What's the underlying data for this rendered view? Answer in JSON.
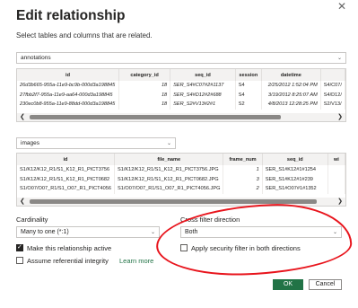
{
  "dialog": {
    "title": "Edit relationship",
    "subtitle": "Select tables and columns that are related."
  },
  "table1": {
    "selected": "annotations",
    "columns": [
      "id",
      "category_id",
      "seq_id",
      "session",
      "datetime"
    ],
    "rows": [
      [
        "26d3b665-955a-11e9-bc9b-000d3a198845",
        "18",
        "SER_S4#C07#2#1137",
        "S4",
        "2/25/2012 1:52:04 PM",
        "S4/C07/"
      ],
      [
        "27fbb2f7-955a-11e9-aa64-000d3a198845",
        "18",
        "SER_S4#D12#2#688",
        "S4",
        "3/19/2012 8:25:07 AM",
        "S4/D12/"
      ],
      [
        "230ec0b8-955a-11e9-88dd-000d3a198845",
        "18",
        "SER_S2#V13#2#1",
        "S2",
        "4/8/2013 12:28:25 PM",
        "S2/V13/"
      ]
    ]
  },
  "table2": {
    "selected": "images",
    "columns": [
      "id",
      "file_name",
      "frame_num",
      "seq_id",
      "wi"
    ],
    "rows": [
      [
        "S1/K12/K12_R1/S1_K12_R1_PICT3756",
        "S1/K12/K12_R1/S1_K12_R1_PICT3756.JPG",
        "1",
        "SER_S1#K12#1#1254"
      ],
      [
        "S1/K12/K12_R1/S1_K12_R1_PICT0682",
        "S1/K12/K12_R1/S1_K12_R1_PICT0682.JPG",
        "3",
        "SER_S1#K12#1#239"
      ],
      [
        "S1/O07/O07_R1/S1_O07_R1_PICT4056",
        "S1/O07/O07_R1/S1_O07_R1_PICT4056.JPG",
        "2",
        "SER_S1#O07#1#1352"
      ]
    ]
  },
  "cardinality": {
    "label": "Cardinality",
    "value": "Many to one (*:1)"
  },
  "cross_filter": {
    "label": "Cross filter direction",
    "value": "Both"
  },
  "options": {
    "make_active": "Make this relationship active",
    "security_filter": "Apply security filter in both directions",
    "referential_integrity": "Assume referential integrity",
    "learn_more": "Learn more"
  },
  "buttons": {
    "ok": "OK",
    "cancel": "Cancel"
  },
  "icons": {
    "close": "✕",
    "caret": "⌄",
    "arrow_left": "❮",
    "arrow_right": "❯"
  },
  "colors": {
    "accent": "#217346",
    "annotation": "#e8141c"
  }
}
